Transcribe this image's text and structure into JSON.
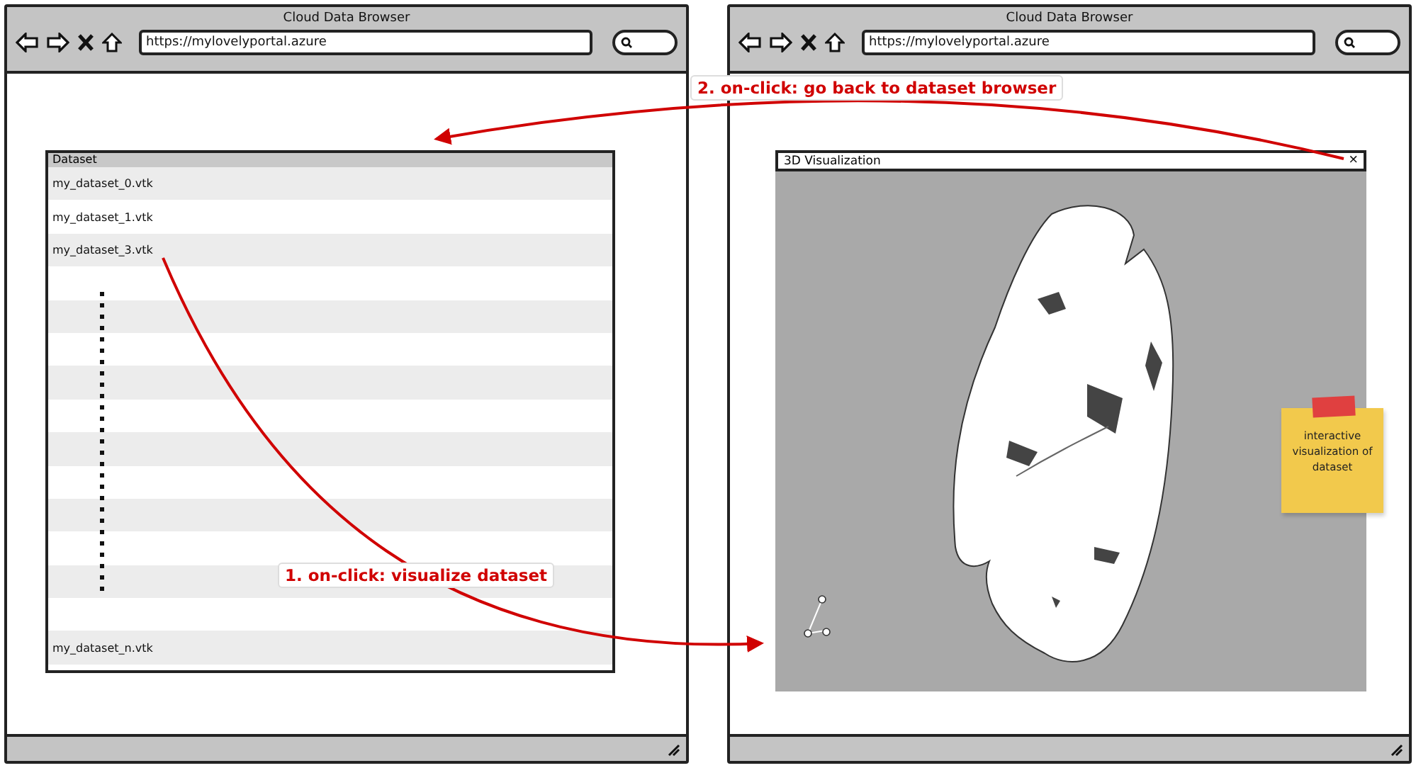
{
  "windows": [
    {
      "kind": "list",
      "title": "Cloud Data Browser",
      "url": "https://mylovelyportal.azure",
      "list": {
        "header": "Dataset",
        "rows": [
          {
            "kind": "item",
            "label": "my_dataset_0.vtk"
          },
          {
            "kind": "item",
            "label": "my_dataset_1.vtk"
          },
          {
            "kind": "item",
            "label": "my_dataset_3.vtk"
          },
          {
            "kind": "gap"
          },
          {
            "kind": "gap"
          },
          {
            "kind": "gap"
          },
          {
            "kind": "gap"
          },
          {
            "kind": "gap"
          },
          {
            "kind": "gap"
          },
          {
            "kind": "gap"
          },
          {
            "kind": "gap"
          },
          {
            "kind": "gap"
          },
          {
            "kind": "gap"
          },
          {
            "kind": "gap"
          },
          {
            "kind": "item",
            "label": "my_dataset_n.vtk"
          }
        ]
      }
    },
    {
      "kind": "viz",
      "title": "Cloud Data Browser",
      "url": "https://mylovelyportal.azure",
      "panel": {
        "title": "3D Visualization",
        "close": "×"
      },
      "sticky_note": "interactive visualization of dataset"
    }
  ],
  "annotations": [
    {
      "kind": "forward",
      "text": "1. on-click: visualize dataset"
    },
    {
      "kind": "back",
      "text": "2. on-click: go back to dataset browser"
    }
  ]
}
